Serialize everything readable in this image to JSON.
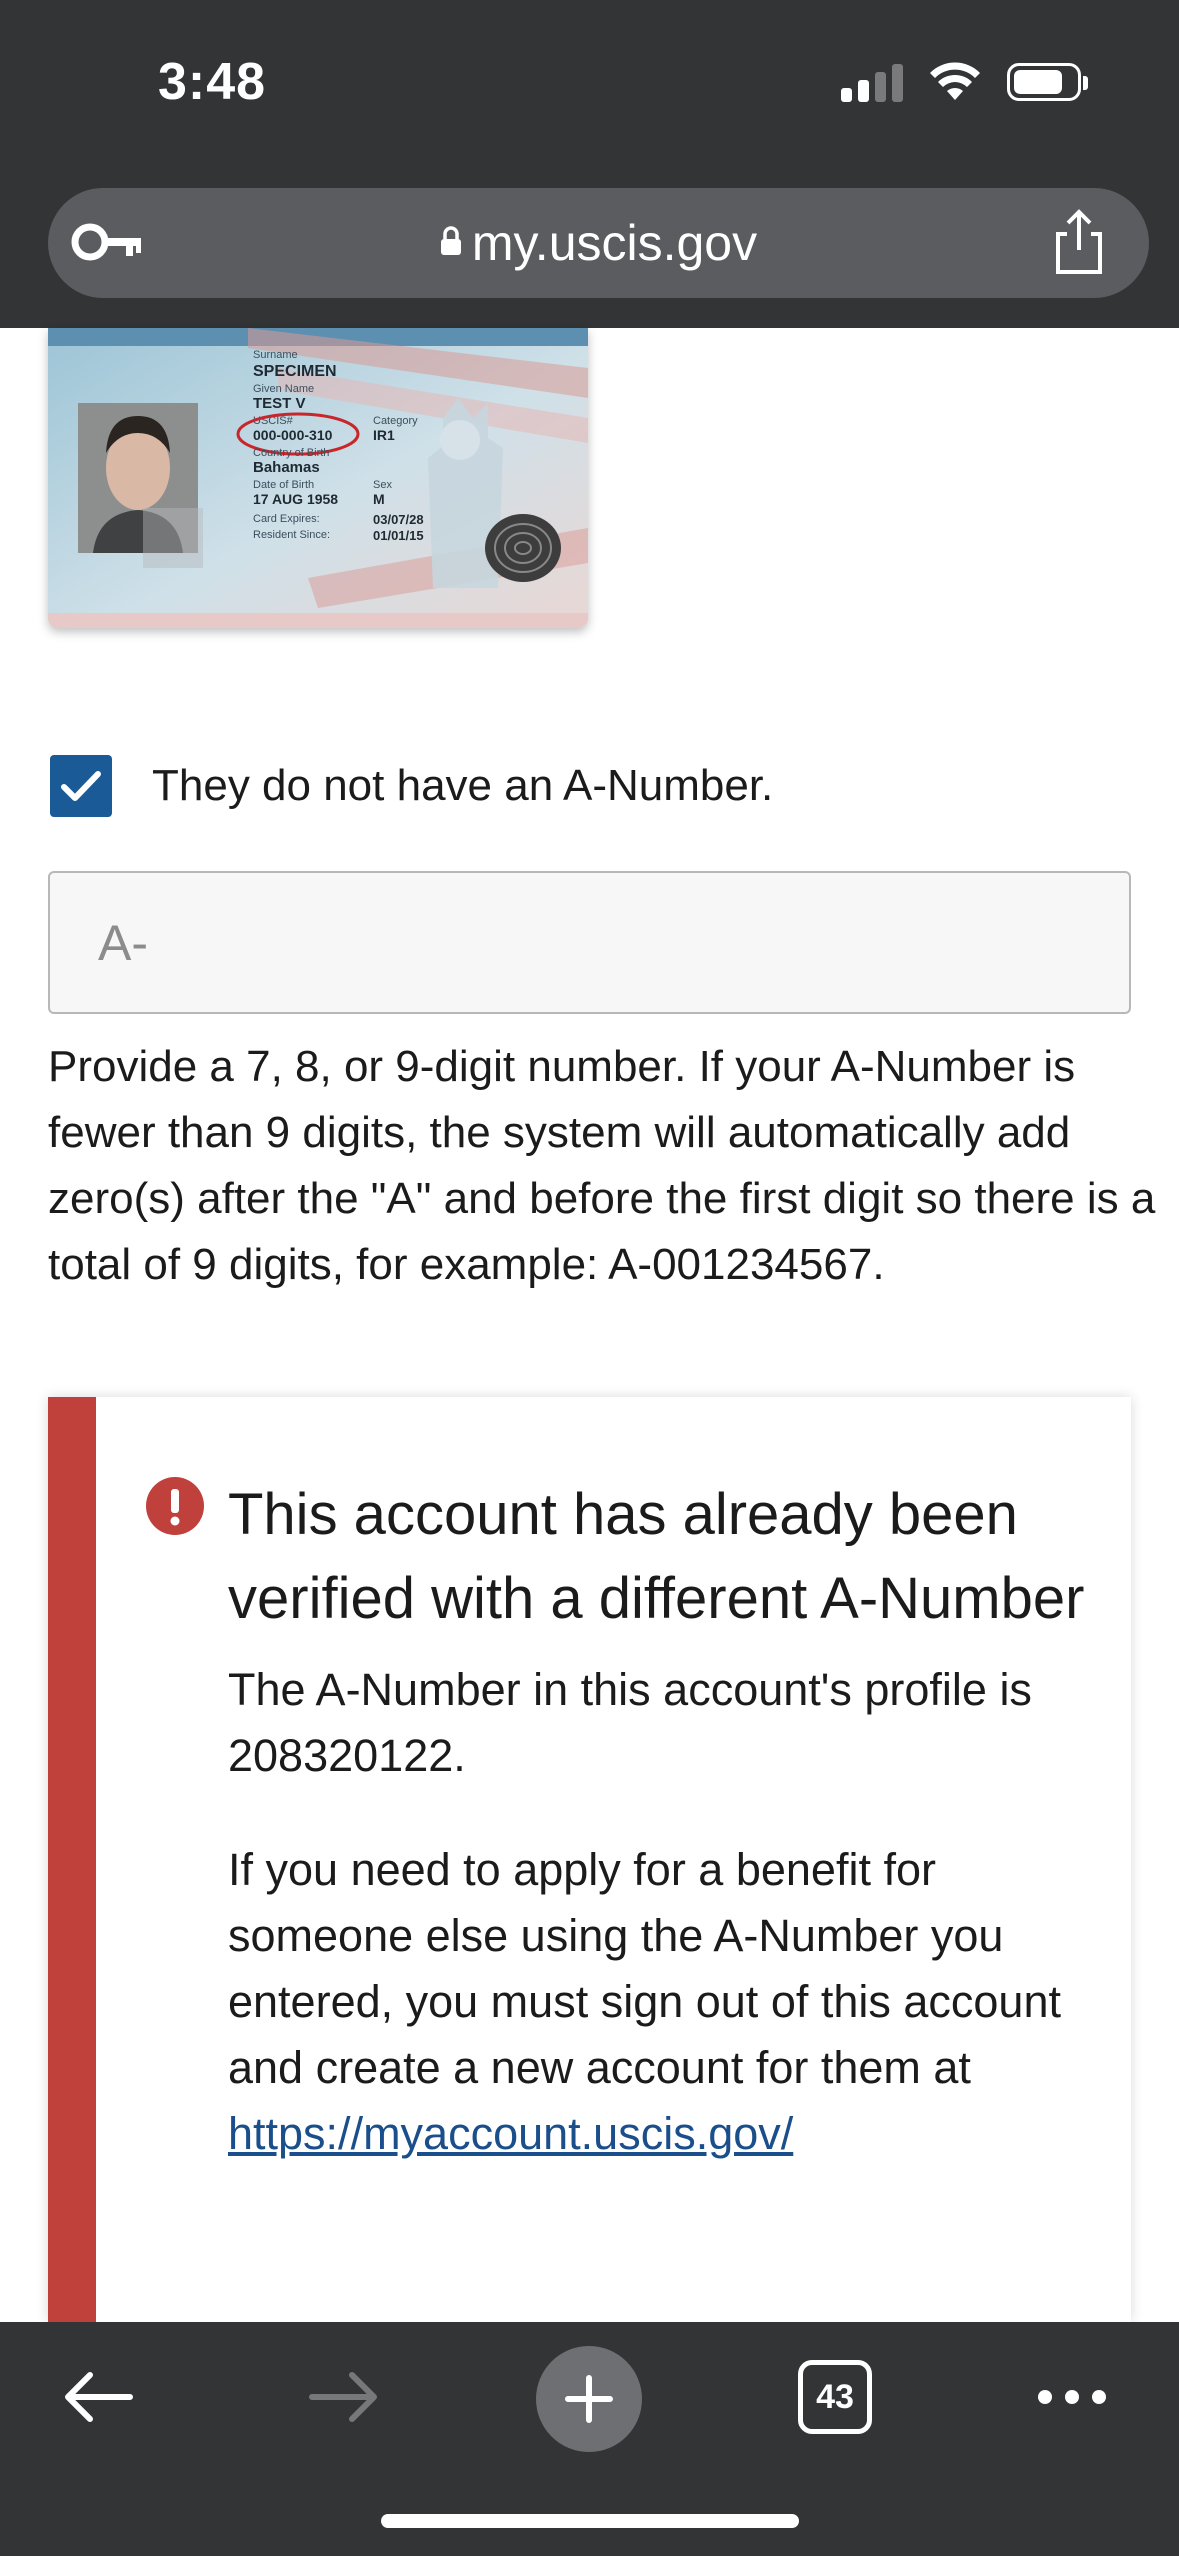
{
  "status_bar": {
    "time": "3:48"
  },
  "browser": {
    "url": "my.uscis.gov",
    "tab_count": "43"
  },
  "id_card": {
    "surname_label": "Surname",
    "surname": "SPECIMEN",
    "given_name_label": "Given Name",
    "given_name": "TEST V",
    "uscis_label": "USCIS#",
    "uscis_number": "000-000-310",
    "category_label": "Category",
    "category": "IR1",
    "country_label": "Country of Birth",
    "country": "Bahamas",
    "dob_label": "Date of Birth",
    "dob": "17 AUG 1958",
    "sex_label": "Sex",
    "sex": "M",
    "expires_label": "Card Expires:",
    "expires": "03/07/28",
    "resident_label": "Resident Since:",
    "resident": "01/01/15"
  },
  "form": {
    "checkbox_label": "They do not have an A-Number.",
    "checkbox_checked": true,
    "a_number_placeholder": "A-",
    "help_text": "Provide a 7, 8, or 9-digit number. If your A-Number is fewer than 9 digits, the system will automatically add zero(s) after the \"A\" and before the first digit so there is a total of 9 digits, for example: A-001234567."
  },
  "alert": {
    "title": "This account has already been verified with a different A-Number",
    "paragraph1": "The A-Number in this account's profile is 208320122.",
    "paragraph2": "If you need to apply for a benefit for someone else using the A-Number you entered, you must sign out of this account and create a new account for them at ",
    "link_text": "https://myaccount.uscis.gov/"
  },
  "colors": {
    "chrome": "#333436",
    "url_bar": "#5b5c5f",
    "checkbox": "#1a5a96",
    "alert_bar": "#c0403c",
    "link": "#1a4f8b"
  }
}
